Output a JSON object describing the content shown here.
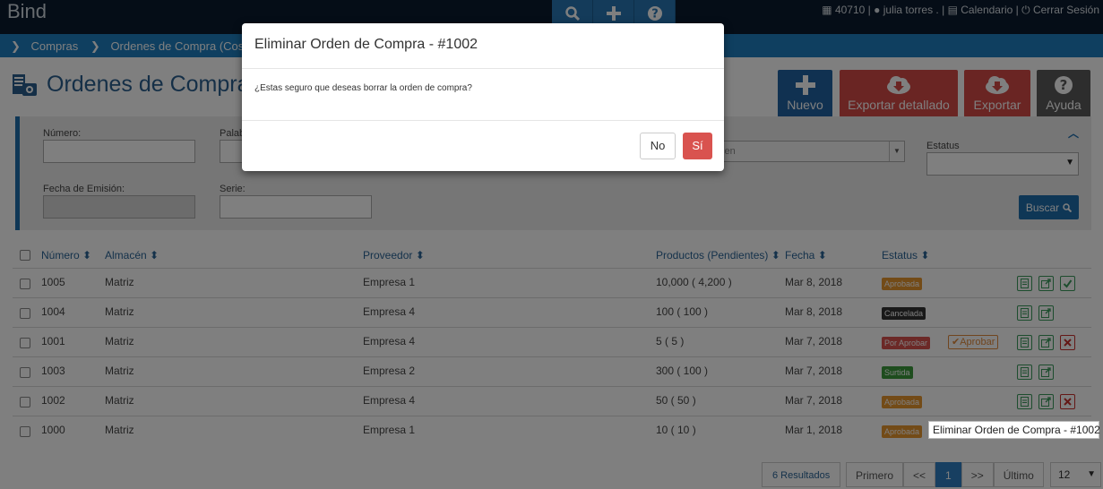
{
  "app": {
    "brand": "Bind"
  },
  "topbar": {
    "account_number": "40710",
    "user_name": "julia torres .",
    "calendar_label": "Calendario",
    "logout_label": "Cerrar Sesión",
    "separator": "|"
  },
  "breadcrumb": {
    "items": [
      "Compras",
      "Ordenes de Compra (Cost"
    ]
  },
  "page": {
    "title": "Ordenes de Compra C"
  },
  "actions": {
    "nuevo": "Nuevo",
    "exportar_detallado": "Exportar detallado",
    "exportar": "Exportar",
    "ayuda": "Ayuda"
  },
  "filters": {
    "numero_label": "Número:",
    "palabra_label": "Palab",
    "almacen_value": "cen",
    "estatus_label": "Estatus",
    "fecha_label": "Fecha de Emisión:",
    "serie_label": "Serie:",
    "buscar_label": "Buscar"
  },
  "table": {
    "headers": {
      "numero": "Número",
      "almacen": "Almacén",
      "proveedor": "Proveedor",
      "productos": "Productos (Pendientes)",
      "fecha": "Fecha",
      "estatus": "Estatus"
    },
    "aprobar_label": "Aprobar",
    "rows": [
      {
        "numero": "1005",
        "almacen": "Matriz",
        "proveedor": "Empresa 1",
        "productos": "10,000 ( 4,200 )",
        "fecha": "Mar 8, 2018",
        "estatus": "Aprobada"
      },
      {
        "numero": "1004",
        "almacen": "Matriz",
        "proveedor": "Empresa 4",
        "productos": "100 ( 100 )",
        "fecha": "Mar 8, 2018",
        "estatus": "Cancelada"
      },
      {
        "numero": "1001",
        "almacen": "Matriz",
        "proveedor": "Empresa 4",
        "productos": "5 ( 5 )",
        "fecha": "Mar 7, 2018",
        "estatus": "Por Aprobar"
      },
      {
        "numero": "1003",
        "almacen": "Matriz",
        "proveedor": "Empresa 2",
        "productos": "300 ( 100 )",
        "fecha": "Mar 7, 2018",
        "estatus": "Surtida"
      },
      {
        "numero": "1002",
        "almacen": "Matriz",
        "proveedor": "Empresa 4",
        "productos": "50 ( 50 )",
        "fecha": "Mar 7, 2018",
        "estatus": "Aprobada"
      },
      {
        "numero": "1000",
        "almacen": "Matriz",
        "proveedor": "Empresa 1",
        "productos": "10 ( 10 )",
        "fecha": "Mar 1, 2018",
        "estatus": "Aprobada"
      }
    ]
  },
  "status_colors": {
    "Aprobada": "#e6962f",
    "Cancelada": "#333333",
    "Por Aprobar": "#d9534f",
    "Surtida": "#3c9a3c"
  },
  "tooltip": {
    "text": "Eliminar Orden de Compra - #1002"
  },
  "pagination": {
    "results": "6 Resultados",
    "first": "Primero",
    "prev": "<<",
    "current": "1",
    "next": ">>",
    "last": "Último",
    "page_size": "12"
  },
  "modal": {
    "title": "Eliminar Orden de Compra - #1002",
    "body": "¿Estas seguro que deseas borrar la orden de compra?",
    "no_label": "No",
    "yes_label": "Sí"
  }
}
